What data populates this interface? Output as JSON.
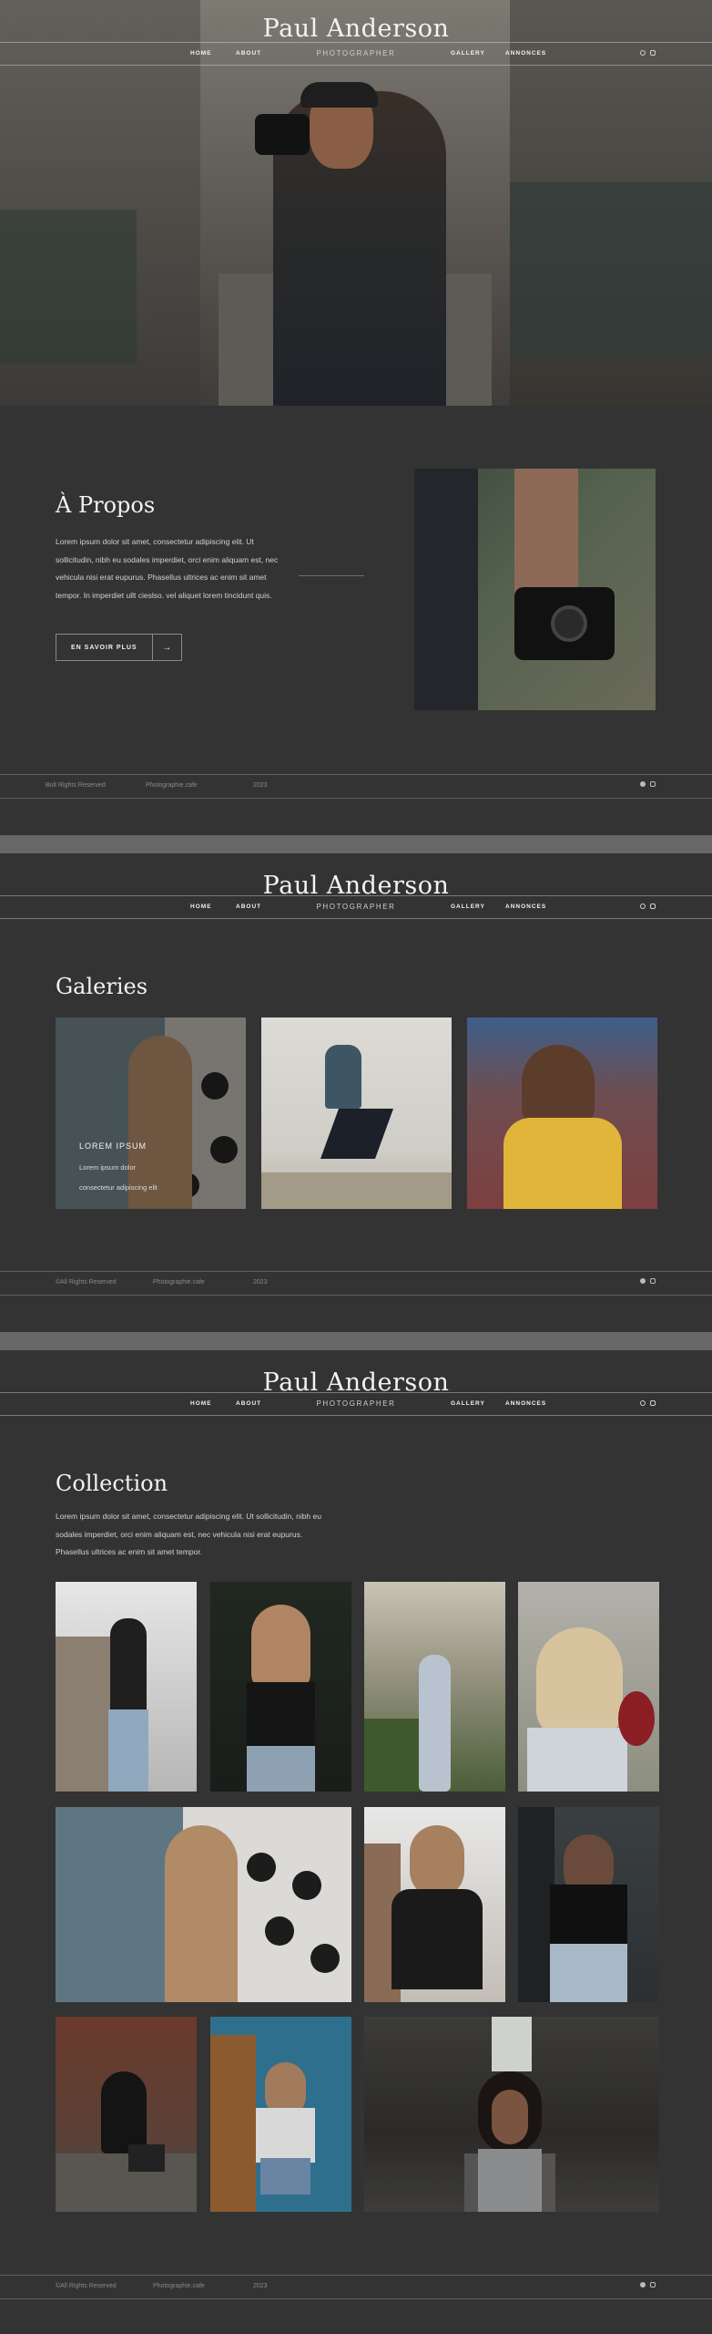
{
  "header": {
    "brand": "Paul Anderson",
    "subtitle": "PHOTOGRAPHER",
    "nav": [
      "HOME",
      "ABOUT",
      "GALLERY",
      "ANNONCES"
    ],
    "social_icons": [
      "facebook-icon",
      "instagram-icon"
    ]
  },
  "about": {
    "title": "À Propos",
    "paragraph": "Lorem ipsum dolor sit amet, consectetur adipiscing elit. Ut sollicitudin, nibh eu sodales imperdiet, orci enim aliquam est, nec vehicula nisi erat eupurus. Phasellus ultrices ac enim sit amet tempor. In imperdiet ullt cieslso. vel aliquet lorem tincidunt quis.",
    "button_label": "EN SAVOIR PLUS",
    "button_arrow": "→"
  },
  "footer1": {
    "rights": "Bolt Rights Reserved",
    "site": "Photographie.cafe",
    "year": "2023"
  },
  "galleries": {
    "title": "Galeries",
    "overlay_title": "LOREM IPSUM",
    "overlay_line1": "Lorem ipsum dolor",
    "overlay_line2": "consectetur adipiscing elit"
  },
  "footer2": {
    "rights": "©All Rights Reserved",
    "site": "Photographie.cafe",
    "year": "2023"
  },
  "collection": {
    "title": "Collection",
    "paragraph": "Lorem ipsum dolor sit amet, consectetur adipiscing elit. Ut sollicitudin, nibh eu sodales imperdiet, orci enim aliquam est, nec vehicula nisi erat eupurus. Phasellus ultrices ac enim sit amet tempor."
  },
  "footer3": {
    "rights": "©All Rights Reserved",
    "site": "Photographie.cafe",
    "year": "2023"
  },
  "colors": {
    "page_bg": "#333333",
    "separator": "#676767",
    "text": "#e6e6e6"
  }
}
